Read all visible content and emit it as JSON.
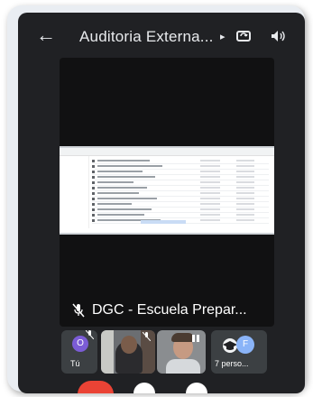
{
  "header": {
    "title": "Auditoria Externa...",
    "back_icon": "arrow-back-icon",
    "caret_icon": "caret-right-icon",
    "camera_switch_icon": "camera-switch-icon",
    "speaker_icon": "speaker-icon"
  },
  "stage": {
    "presenter_name": "DGC - Escuela Prepar...",
    "presenter_muted_icon": "mic-off-icon"
  },
  "participants": {
    "self_label": "Tú",
    "self_initial": "O",
    "more_initial": "F",
    "more_label": "7 perso..."
  },
  "colors": {
    "background": "#202124",
    "end_call": "#ea4335",
    "self_avatar": "#7b5cd6",
    "more_avatar": "#8ab4f8"
  }
}
